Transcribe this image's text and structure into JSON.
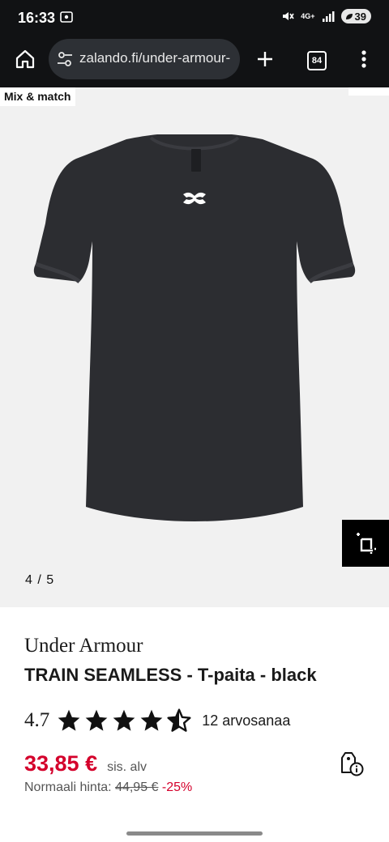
{
  "status_bar": {
    "time": "16:33",
    "network": "4G+",
    "battery": "39"
  },
  "browser": {
    "url": "zalando.fi/under-armour-",
    "tab_count": "84"
  },
  "gallery": {
    "badge": "Mix & match",
    "counter": "4 / 5",
    "garment_color": "#2c2d31"
  },
  "product": {
    "brand": "Under Armour",
    "name": "TRAIN SEAMLESS - T-paita - black",
    "rating": "4.7",
    "stars_filled": 4.5,
    "reviews": "12 arvosanaa",
    "price": "33,85 €",
    "vat": "sis. alv",
    "original_label": "Normaali hinta:",
    "original_price": "44,95 €",
    "discount": "-25%"
  },
  "colors": {
    "accent_red": "#d4002b",
    "bar_bg": "#111214"
  }
}
